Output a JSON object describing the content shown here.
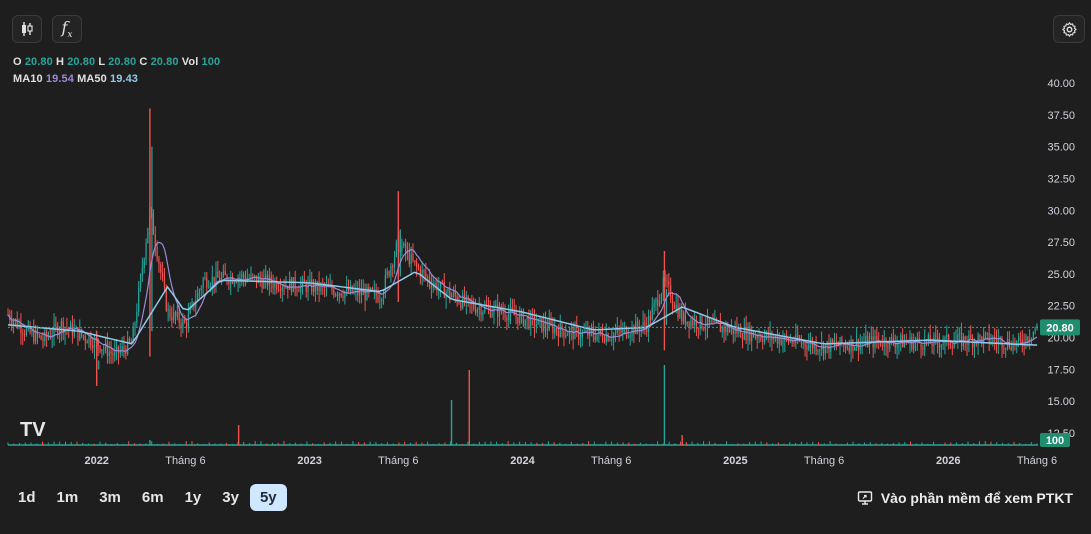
{
  "toolbar": {
    "candles_icon": "candlestick-icon",
    "indicator_icon": "function-icon",
    "indicator_label": "f",
    "indicator_sub": "x",
    "settings_icon": "gear-icon"
  },
  "legend": {
    "o_label": "O",
    "o_value": "20.80",
    "h_label": "H",
    "h_value": "20.80",
    "l_label": "L",
    "l_value": "20.80",
    "c_label": "C",
    "c_value": "20.80",
    "vol_label": "Vol",
    "vol_value": "100",
    "ma10_label": "MA10",
    "ma10_value": "19.54",
    "ma50_label": "MA50",
    "ma50_value": "19.43"
  },
  "price_tag": "20.80",
  "volume_tag": "100",
  "watermark": "TV",
  "ranges": [
    "1d",
    "1m",
    "3m",
    "6m",
    "1y",
    "3y",
    "5y"
  ],
  "active_range": "5y",
  "cta_label": "Vào phần mềm để xem PTKT",
  "colors": {
    "up": "#26a69a",
    "down": "#ef5350",
    "ma10": "#9c8bd6",
    "ma50": "#8fcbe8",
    "tag_bg": "#1e8e6e"
  },
  "chart_data": {
    "type": "candlestick",
    "y_ticks": [
      "40.00",
      "37.50",
      "35.00",
      "32.50",
      "30.00",
      "27.50",
      "25.00",
      "22.50",
      "20.00",
      "17.50",
      "15.00",
      "12.50"
    ],
    "ylim": [
      12.5,
      40
    ],
    "x_tick_labels": [
      "2022",
      "Tháng 6",
      "2023",
      "Tháng 6",
      "2024",
      "Tháng 6",
      "2025",
      "Tháng 6",
      "2026",
      "Tháng 6"
    ],
    "x_tick_dates": [
      "2022-01",
      "2022-06",
      "2023-01",
      "2023-06",
      "2024-01",
      "2024-06",
      "2025-01",
      "2025-06",
      "2026-01",
      "2026-06"
    ],
    "xlim": [
      "2021-08",
      "2026-06"
    ],
    "last_price": 20.8,
    "close_path": [
      {
        "t": "2021-08",
        "v": 21.8
      },
      {
        "t": "2021-09",
        "v": 20.5
      },
      {
        "t": "2021-10",
        "v": 19.8
      },
      {
        "t": "2021-11",
        "v": 21.0
      },
      {
        "t": "2021-12",
        "v": 20.3
      },
      {
        "t": "2022-01",
        "v": 19.6
      },
      {
        "t": "2022-02",
        "v": 18.6
      },
      {
        "t": "2022-03",
        "v": 19.6
      },
      {
        "t": "2022-04",
        "v": 30.0
      },
      {
        "t": "2022-05",
        "v": 22.0
      },
      {
        "t": "2022-06",
        "v": 21.0
      },
      {
        "t": "2022-07",
        "v": 24.5
      },
      {
        "t": "2022-09",
        "v": 24.8
      },
      {
        "t": "2022-11",
        "v": 24.3
      },
      {
        "t": "2023-01",
        "v": 24.0
      },
      {
        "t": "2023-03",
        "v": 23.6
      },
      {
        "t": "2023-05",
        "v": 23.3
      },
      {
        "t": "2023-06",
        "v": 27.5
      },
      {
        "t": "2023-07",
        "v": 25.5
      },
      {
        "t": "2023-08",
        "v": 24.2
      },
      {
        "t": "2023-10",
        "v": 22.5
      },
      {
        "t": "2023-12",
        "v": 22.0
      },
      {
        "t": "2024-02",
        "v": 21.0
      },
      {
        "t": "2024-04",
        "v": 20.3
      },
      {
        "t": "2024-06",
        "v": 20.2
      },
      {
        "t": "2024-08",
        "v": 21.0
      },
      {
        "t": "2024-09",
        "v": 24.3
      },
      {
        "t": "2024-10",
        "v": 21.5
      },
      {
        "t": "2024-12",
        "v": 20.8
      },
      {
        "t": "2025-03",
        "v": 20.0
      },
      {
        "t": "2025-06",
        "v": 19.3
      },
      {
        "t": "2025-09",
        "v": 19.7
      },
      {
        "t": "2025-12",
        "v": 19.6
      },
      {
        "t": "2026-03",
        "v": 19.9
      },
      {
        "t": "2026-05",
        "v": 19.5
      },
      {
        "t": "2026-06",
        "v": 20.8
      }
    ],
    "spikes": [
      {
        "t": "2022-04",
        "high": 38.0,
        "low": 18.5
      },
      {
        "t": "2023-06",
        "high": 31.5,
        "low": 22.8
      },
      {
        "t": "2024-09",
        "high": 26.8,
        "low": 19.0
      },
      {
        "t": "2022-01",
        "high": 20.5,
        "low": 16.2
      }
    ],
    "ma50_path": [
      {
        "t": "2021-08",
        "v": 21.0
      },
      {
        "t": "2021-12",
        "v": 20.5
      },
      {
        "t": "2022-03",
        "v": 19.5
      },
      {
        "t": "2022-05",
        "v": 24.0
      },
      {
        "t": "2022-06",
        "v": 22.0
      },
      {
        "t": "2022-08",
        "v": 24.5
      },
      {
        "t": "2023-01",
        "v": 24.3
      },
      {
        "t": "2023-05",
        "v": 23.6
      },
      {
        "t": "2023-07",
        "v": 25.2
      },
      {
        "t": "2023-09",
        "v": 23.0
      },
      {
        "t": "2024-01",
        "v": 22.0
      },
      {
        "t": "2024-05",
        "v": 20.6
      },
      {
        "t": "2024-08",
        "v": 20.8
      },
      {
        "t": "2024-10",
        "v": 22.4
      },
      {
        "t": "2025-01",
        "v": 20.8
      },
      {
        "t": "2025-06",
        "v": 19.5
      },
      {
        "t": "2025-12",
        "v": 19.8
      },
      {
        "t": "2026-06",
        "v": 19.4
      }
    ],
    "volume_spikes": [
      {
        "t": "2022-04",
        "v": 5
      },
      {
        "t": "2022-09",
        "v": 20
      },
      {
        "t": "2023-09",
        "v": 45
      },
      {
        "t": "2023-10",
        "v": 75
      },
      {
        "t": "2024-09",
        "v": 80
      },
      {
        "t": "2024-10",
        "v": 10
      }
    ]
  }
}
